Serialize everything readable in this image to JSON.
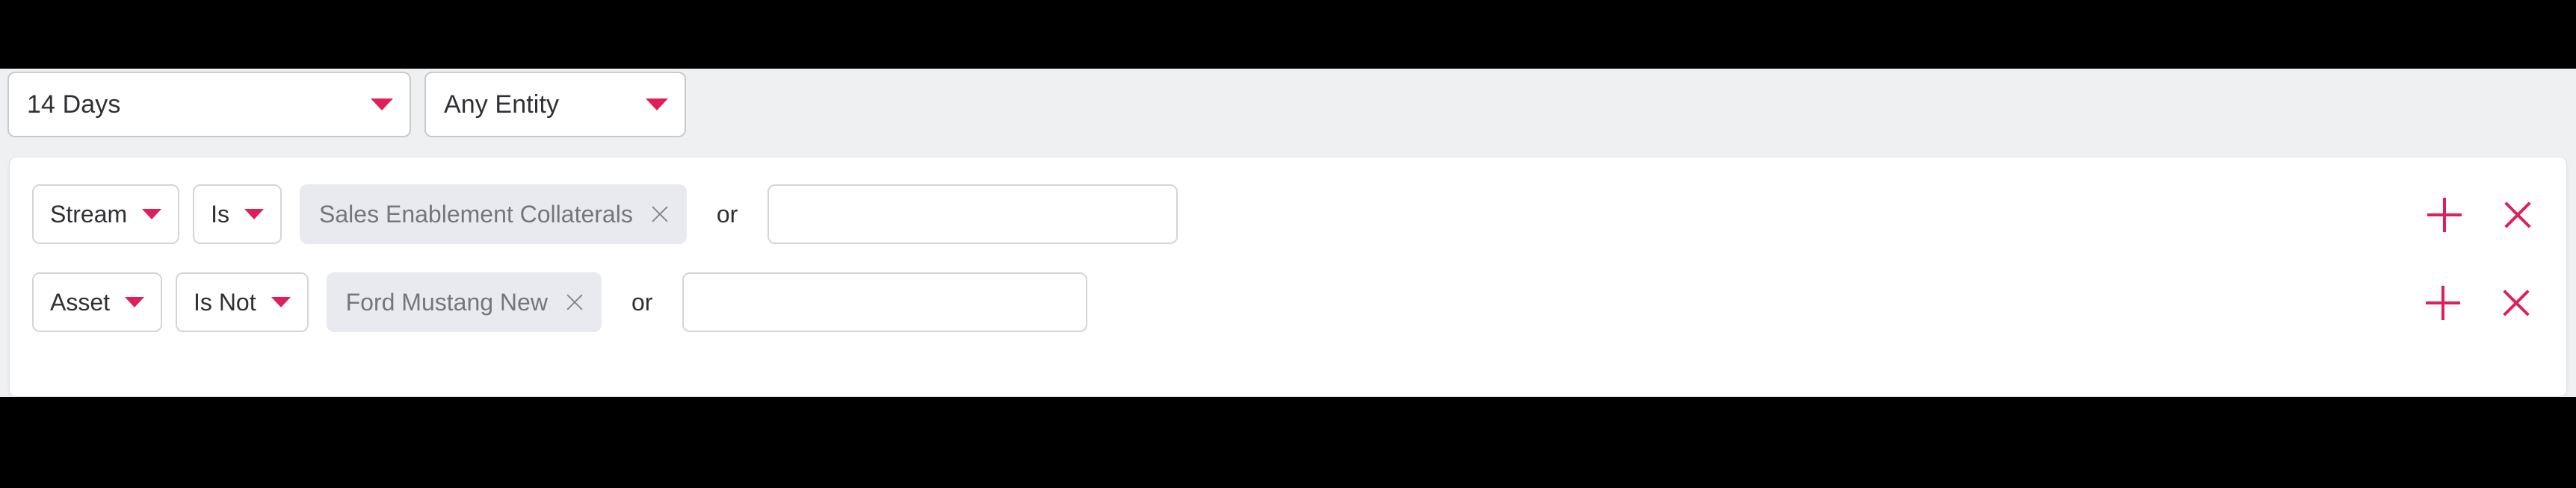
{
  "top_filters": [
    {
      "name": "date-range",
      "label": "14 Days",
      "caret": "chevron-down-icon"
    },
    {
      "name": "entity",
      "label": "Any Entity",
      "caret": "chevron-down-icon"
    }
  ],
  "filter_card": {
    "rows": [
      {
        "field": {
          "label": "Stream",
          "caret": "chevron-down-icon"
        },
        "operator": {
          "label": "Is",
          "caret": "chevron-down-icon"
        },
        "chip": {
          "label": "Sales Enablement Collaterals",
          "remove_icon": "close-icon"
        },
        "conjunction": "or",
        "input": {
          "value": "",
          "placeholder": ""
        },
        "actions": {
          "add_icon": "plus-icon",
          "remove_icon": "close-icon"
        }
      },
      {
        "field": {
          "label": "Asset",
          "caret": "chevron-down-icon"
        },
        "operator": {
          "label": "Is Not",
          "caret": "chevron-down-icon"
        },
        "chip": {
          "label": "Ford Mustang New",
          "remove_icon": "close-icon"
        },
        "conjunction": "or",
        "input": {
          "value": "",
          "placeholder": ""
        },
        "actions": {
          "add_icon": "plus-icon",
          "remove_icon": "close-icon"
        }
      }
    ]
  },
  "colors": {
    "accent_pink": "#e01e5a",
    "page_background": "#eff0f2",
    "card_background": "#ffffff",
    "chip_background": "#e9eaef",
    "chip_text": "#74767b",
    "text_primary": "#2f3033",
    "border": "#d4d5d7",
    "bar_black": "#000000"
  }
}
